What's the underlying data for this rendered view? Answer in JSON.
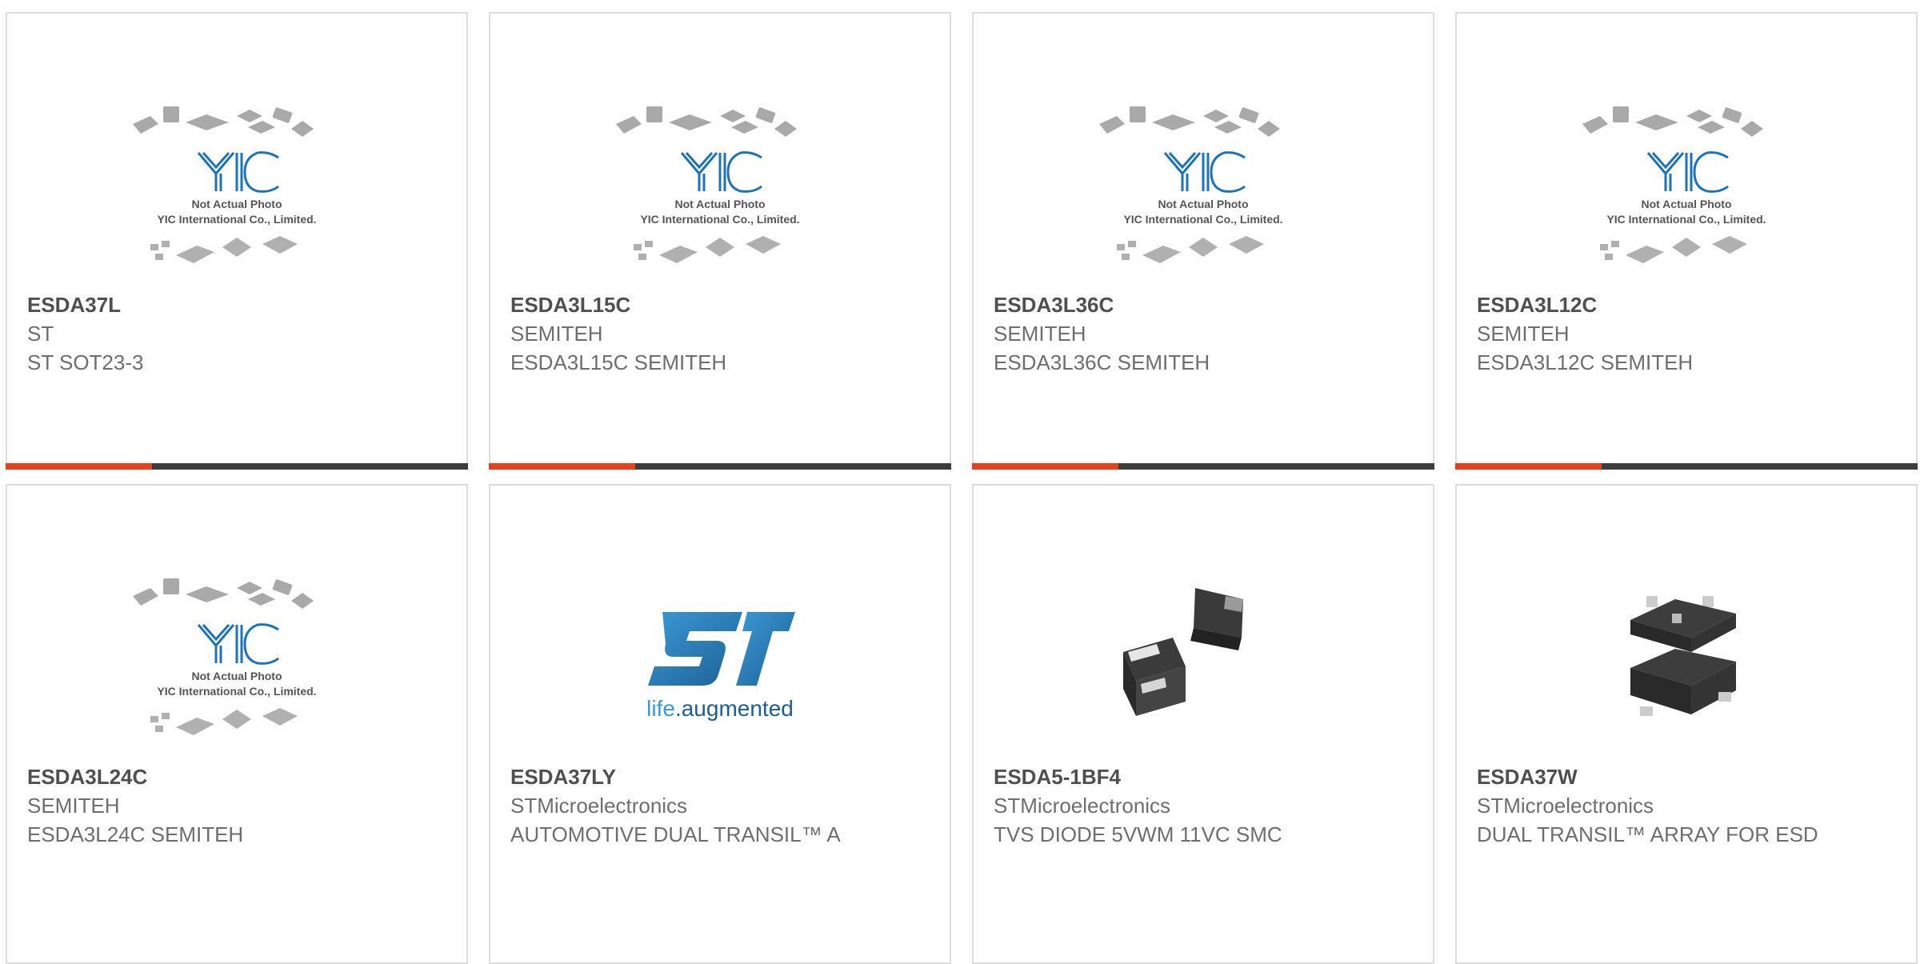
{
  "products": [
    {
      "part_number": "ESDA37L",
      "manufacturer": "ST",
      "description": "ST SOT23-3",
      "image": "yic-placeholder"
    },
    {
      "part_number": "ESDA3L15C",
      "manufacturer": "SEMITEH",
      "description": "ESDA3L15C SEMITEH",
      "image": "yic-placeholder"
    },
    {
      "part_number": "ESDA3L36C",
      "manufacturer": "SEMITEH",
      "description": "ESDA3L36C SEMITEH",
      "image": "yic-placeholder"
    },
    {
      "part_number": "ESDA3L12C",
      "manufacturer": "SEMITEH",
      "description": "ESDA3L12C SEMITEH",
      "image": "yic-placeholder"
    },
    {
      "part_number": "ESDA3L24C",
      "manufacturer": "SEMITEH",
      "description": "ESDA3L24C SEMITEH",
      "image": "yic-placeholder"
    },
    {
      "part_number": "ESDA37LY",
      "manufacturer": "STMicroelectronics",
      "description": "AUTOMOTIVE DUAL TRANSIL™ A",
      "image": "st-logo"
    },
    {
      "part_number": "ESDA5-1BF4",
      "manufacturer": "STMicroelectronics",
      "description": "TVS DIODE 5VWM 11VC SMC",
      "image": "two-chip-photo"
    },
    {
      "part_number": "ESDA37W",
      "manufacturer": "STMicroelectronics",
      "description": "DUAL TRANSIL™ ARRAY FOR ESD",
      "image": "sot23-photo"
    }
  ],
  "placeholder": {
    "caption_line1": "Not Actual Photo",
    "caption_line2": "YIC International Co., Limited.",
    "logo_text": "YIC"
  },
  "st_logo": {
    "tagline_a": "life",
    "tagline_b": ".augmented"
  },
  "colors": {
    "accent": "#e8401c",
    "bar": "#3d3d3d",
    "logo_blue": "#1e73b8",
    "st_blue": "#2a7ab8"
  }
}
